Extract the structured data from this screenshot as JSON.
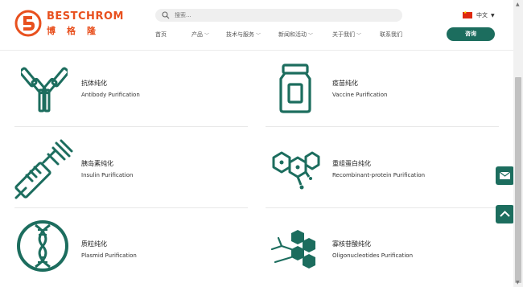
{
  "brand": {
    "name_en": "BESTCHROM",
    "name_cn": "博格隆"
  },
  "search": {
    "placeholder": "搜索..."
  },
  "language": {
    "label": "中文"
  },
  "nav": [
    {
      "label": "首页",
      "dropdown": false
    },
    {
      "label": "产品",
      "dropdown": true
    },
    {
      "label": "技术与服务",
      "dropdown": true
    },
    {
      "label": "新闻和活动",
      "dropdown": true
    },
    {
      "label": "关于我们",
      "dropdown": true
    },
    {
      "label": "联系我们",
      "dropdown": false
    }
  ],
  "cta": {
    "label": "咨询"
  },
  "products": [
    {
      "cn": "抗体纯化",
      "en": "Antibody Purification",
      "icon": "antibody-icon"
    },
    {
      "cn": "疫苗纯化",
      "en": "Vaccine Purification",
      "icon": "vaccine-bottle-icon"
    },
    {
      "cn": "胰岛素纯化",
      "en": "Insulin Purification",
      "icon": "syringe-icon"
    },
    {
      "cn": "重组蛋白纯化",
      "en": "Recombinant-protein Purification",
      "icon": "molecule-icon"
    },
    {
      "cn": "质粒纯化",
      "en": "Plasmid Purification",
      "icon": "plasmid-dna-icon"
    },
    {
      "cn": "寡核苷酸纯化",
      "en": "Oligonucleotides Purification",
      "icon": "hexagon-network-icon"
    }
  ],
  "colors": {
    "brand": "#e8501e",
    "primary": "#1c6d5e"
  }
}
